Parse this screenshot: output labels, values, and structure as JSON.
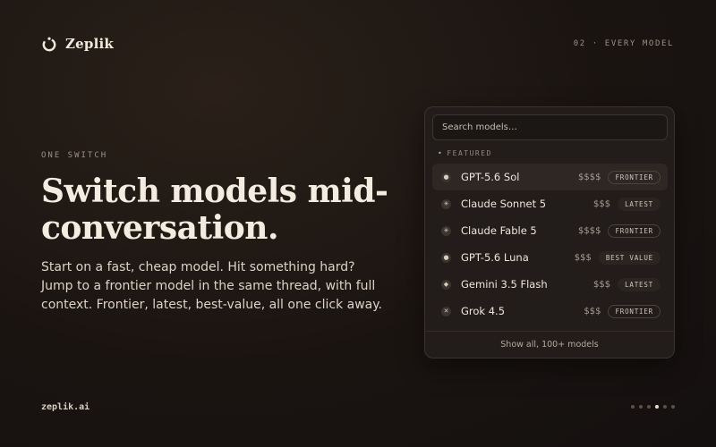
{
  "brand": {
    "name": "Zeplik",
    "logo_icon": "power-ring-icon"
  },
  "section_tag": "02 · EVERY MODEL",
  "eyebrow": "ONE SWITCH",
  "headline": "Switch models mid-conversation.",
  "body": "Start on a fast, cheap model. Hit something hard? Jump to a frontier model in the same thread, with full context. Frontier, latest, best-value, all one click away.",
  "footer_url": "zeplik.ai",
  "pager": {
    "count": 6,
    "active_index": 3
  },
  "picker": {
    "search_placeholder": "Search models…",
    "group_label": "FEATURED",
    "group_icon": "dot-icon",
    "models": [
      {
        "icon": "filled-circle-icon",
        "glyph": "●",
        "name": "GPT-5.6 Sol",
        "price": "$$$$",
        "badge": "FRONTIER",
        "badge_style": "outline",
        "selected": true
      },
      {
        "icon": "asterisk-icon",
        "glyph": "✳",
        "name": "Claude Sonnet 5",
        "price": "$$$",
        "badge": "LATEST",
        "badge_style": "plain",
        "selected": false
      },
      {
        "icon": "asterisk-icon",
        "glyph": "✳",
        "name": "Claude Fable 5",
        "price": "$$$$",
        "badge": "FRONTIER",
        "badge_style": "outline",
        "selected": false
      },
      {
        "icon": "filled-circle-icon",
        "glyph": "●",
        "name": "GPT-5.6 Luna",
        "price": "$$$",
        "badge": "BEST VALUE",
        "badge_style": "plain",
        "selected": false
      },
      {
        "icon": "diamond-icon",
        "glyph": "◆",
        "name": "Gemini 3.5 Flash",
        "price": "$$$",
        "badge": "LATEST",
        "badge_style": "plain",
        "selected": false
      },
      {
        "icon": "x-icon",
        "glyph": "✕",
        "name": "Grok 4.5",
        "price": "$$$",
        "badge": "FRONTIER",
        "badge_style": "outline",
        "selected": false
      }
    ],
    "footer_link": "Show all, 100+ models"
  }
}
